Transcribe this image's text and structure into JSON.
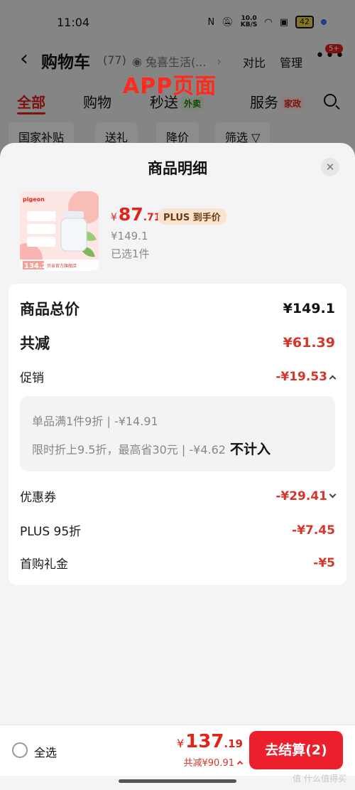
{
  "status_bar": {
    "time": "11:04",
    "speed_value": "10.0",
    "speed_unit": "KB/S",
    "battery": "42"
  },
  "cart_header": {
    "title": "购物车",
    "count": "(77)",
    "address": "兔喜生活(...",
    "compare_label": "对比",
    "manage_label": "管理",
    "message_badge": "5+"
  },
  "overlay_label": "APP页面",
  "cart_tabs": {
    "all": "全部",
    "shopping": "购物",
    "flash": "秒送",
    "flash_badge": "外卖",
    "service": "服务",
    "service_badge": "家政"
  },
  "filters": {
    "subsidy": "国家补贴",
    "gift": "送礼",
    "price_drop": "降价",
    "filter": "筛选"
  },
  "sheet": {
    "title": "商品明细",
    "product": {
      "image_price": "134.2",
      "image_caption": "贝亲官方旗舰店",
      "price_yen": "¥",
      "price_int": "87",
      "price_dec": ".71",
      "plus_tag": "PLUS 到手价",
      "original_price": "¥149.1",
      "selected_qty": "已选1件"
    },
    "details": {
      "total_label": "商品总价",
      "total_value": "¥149.1",
      "reduce_label": "共减",
      "reduce_value": "¥61.39",
      "promo_label": "促销",
      "promo_value": "-¥19.53",
      "promo_line1": "单品满1件9折 | -¥14.91",
      "promo_line2": "限时折上9.5折，最高省30元 | -¥4.62",
      "promo_line2_note": "不计入",
      "coupon_label": "优惠券",
      "coupon_value": "-¥29.41",
      "plus_label": "PLUS 95折",
      "plus_value": "-¥7.45",
      "first_gift_label": "首购礼金",
      "first_gift_value": "-¥5"
    }
  },
  "bottom_bar": {
    "select_all": "全选",
    "total_yen": "¥",
    "total_int": "137",
    "total_dec": ".19",
    "total_saved": "共减¥90.91",
    "checkout": "去结算(2)"
  },
  "watermark": "值 什么值得买"
}
